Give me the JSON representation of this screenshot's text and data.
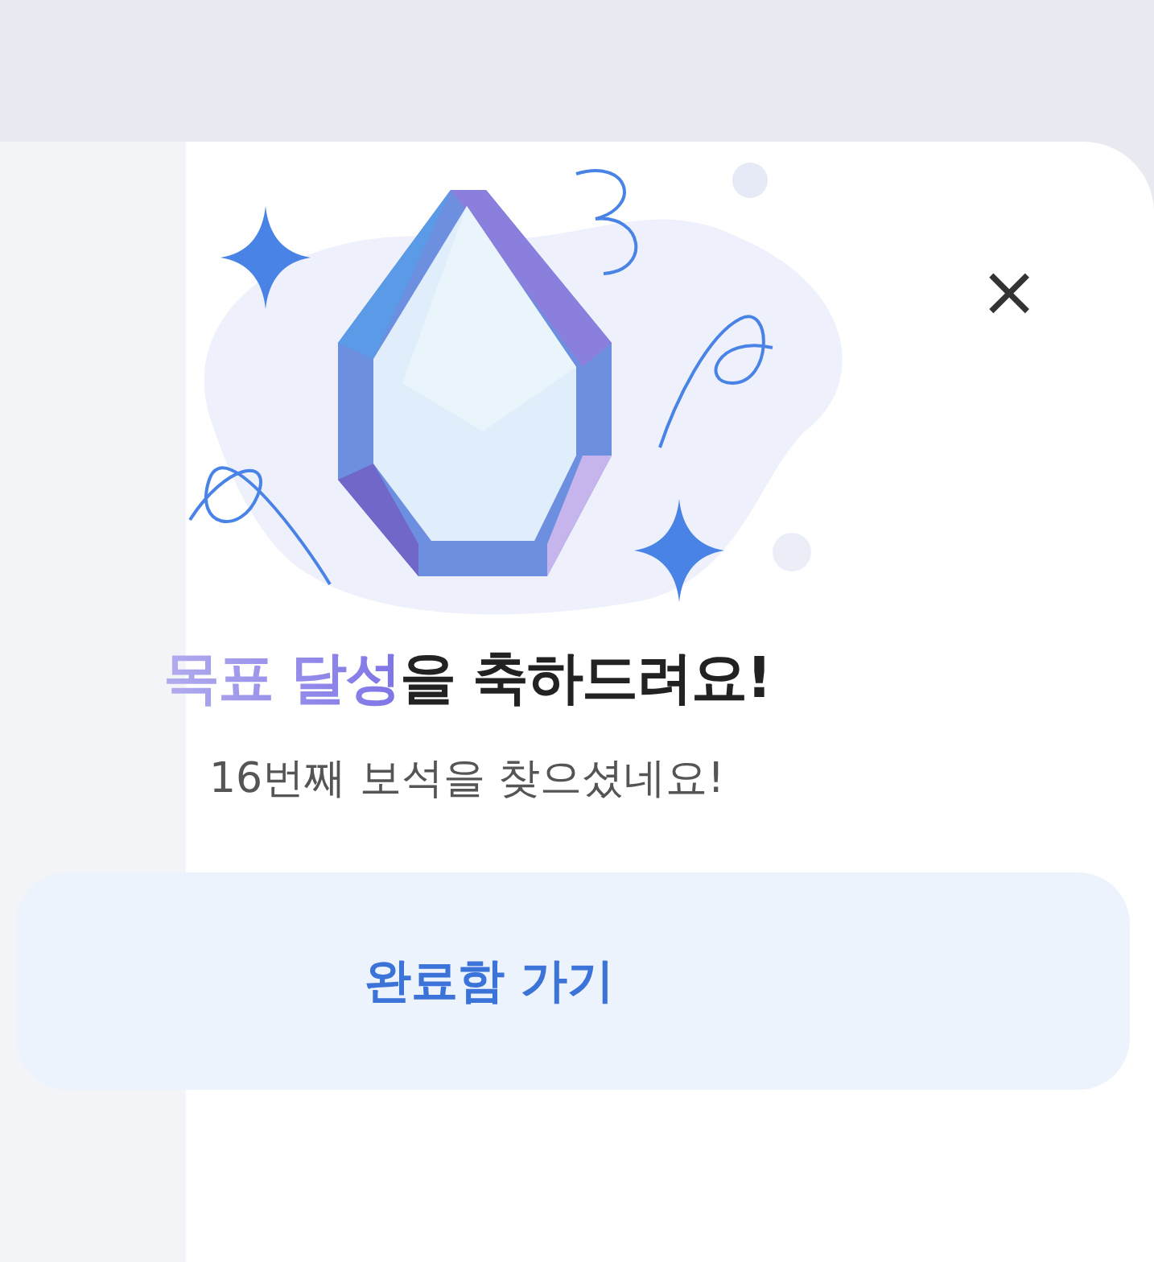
{
  "close_button": {
    "label": "×"
  },
  "title": {
    "highlight": "목표 달성",
    "rest": "을 축하드려요!"
  },
  "subtitle": "16번째 보석을 찾으셨네요!",
  "buttons": [
    "완료함 가기"
  ]
}
